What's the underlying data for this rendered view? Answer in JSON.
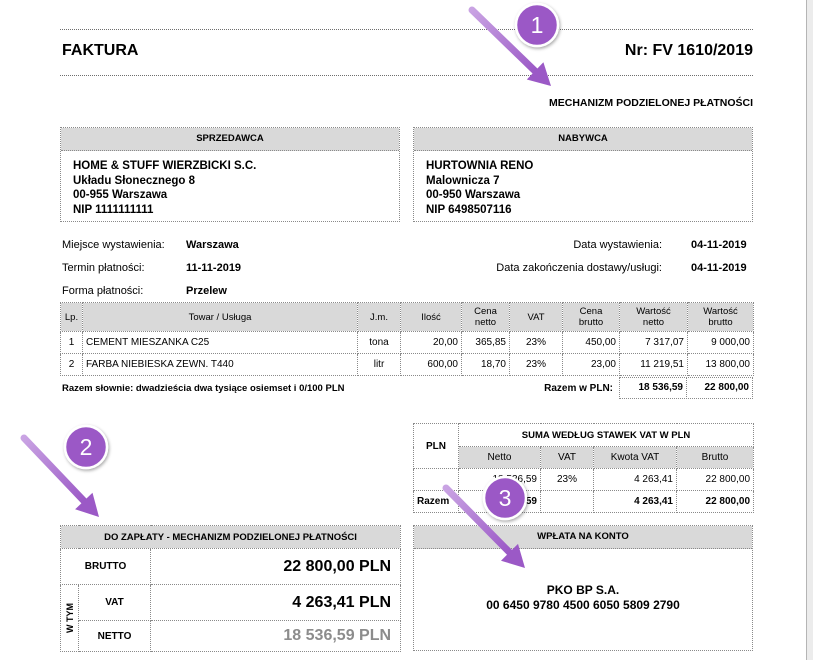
{
  "header": {
    "title": "FAKTURA",
    "number": "Nr: FV 1610/2019",
    "split_payment_note": "MECHANIZM PODZIELONEJ PŁATNOŚCI"
  },
  "seller": {
    "heading": "SPRZEDAWCA",
    "name": "HOME & STUFF WIERZBICKI S.C.",
    "street": "Układu Słonecznego 8",
    "city": "00-955 Warszawa",
    "nip": "NIP 1111111111"
  },
  "buyer": {
    "heading": "NABYWCA",
    "name": "HURTOWNIA RENO",
    "street": "Malownicza 7",
    "city": "00-950 Warszawa",
    "nip": "NIP 6498507116"
  },
  "details": {
    "place_label": "Miejsce wystawienia:",
    "place": "Warszawa",
    "due_label": "Termin płatności:",
    "due": "11-11-2019",
    "method_label": "Forma płatności:",
    "method": "Przelew",
    "issue_date_label": "Data wystawienia:",
    "issue_date": "04-11-2019",
    "delivery_date_label": "Data zakończenia dostawy/usługi:",
    "delivery_date": "04-11-2019"
  },
  "items": {
    "columns": [
      "Lp.",
      "Towar / Usługa",
      "J.m.",
      "Ilość",
      "Cena\nnetto",
      "VAT",
      "Cena\nbrutto",
      "Wartość\nnetto",
      "Wartość\nbrutto"
    ],
    "rows": [
      [
        "1",
        "CEMENT MIESZANKA C25",
        "tona",
        "20,00",
        "365,85",
        "23%",
        "450,00",
        "7 317,07",
        "9 000,00"
      ],
      [
        "2",
        "FARBA NIEBIESKA ZEWN. T440",
        "litr",
        "600,00",
        "18,70",
        "23%",
        "23,00",
        "11 219,51",
        "13 800,00"
      ]
    ],
    "amount_in_words": "Razem słownie: dwadzieścia dwa tysiące osiemset i 0/100 PLN",
    "total_label": "Razem w PLN:",
    "total_net": "18 536,59",
    "total_gross": "22 800,00"
  },
  "vat_summary": {
    "currency": "PLN",
    "title": "SUMA WEDŁUG STAWEK VAT W PLN",
    "columns": [
      "Netto",
      "VAT",
      "Kwota VAT",
      "Brutto"
    ],
    "rows": [
      [
        "18 536,59",
        "23%",
        "4 263,41",
        "22 800,00"
      ]
    ],
    "total_label": "Razem",
    "total_net": "18 536,59",
    "total_vat_amount": "4 263,41",
    "total_gross": "22 800,00"
  },
  "to_pay": {
    "title": "DO ZAPŁATY - MECHANIZM PODZIELONEJ PŁATNOŚCI",
    "gross_label": "BRUTTO",
    "gross_value": "22 800,00 PLN",
    "including_label": "W TYM",
    "vat_label": "VAT",
    "vat_value": "4 263,41 PLN",
    "net_label": "NETTO",
    "net_value": "18 536,59 PLN"
  },
  "payment": {
    "title": "WPŁATA NA KONTO",
    "bank": "PKO BP S.A.",
    "account": "00 6450 9780 4500 6050 5809 2790"
  },
  "annotations": [
    "1",
    "2",
    "3"
  ],
  "colors": {
    "annotation": "#9b59c6",
    "annotation_light": "#c9a3e3",
    "header_fill": "#d9d9d9",
    "muted_value": "#8c8c8c"
  }
}
